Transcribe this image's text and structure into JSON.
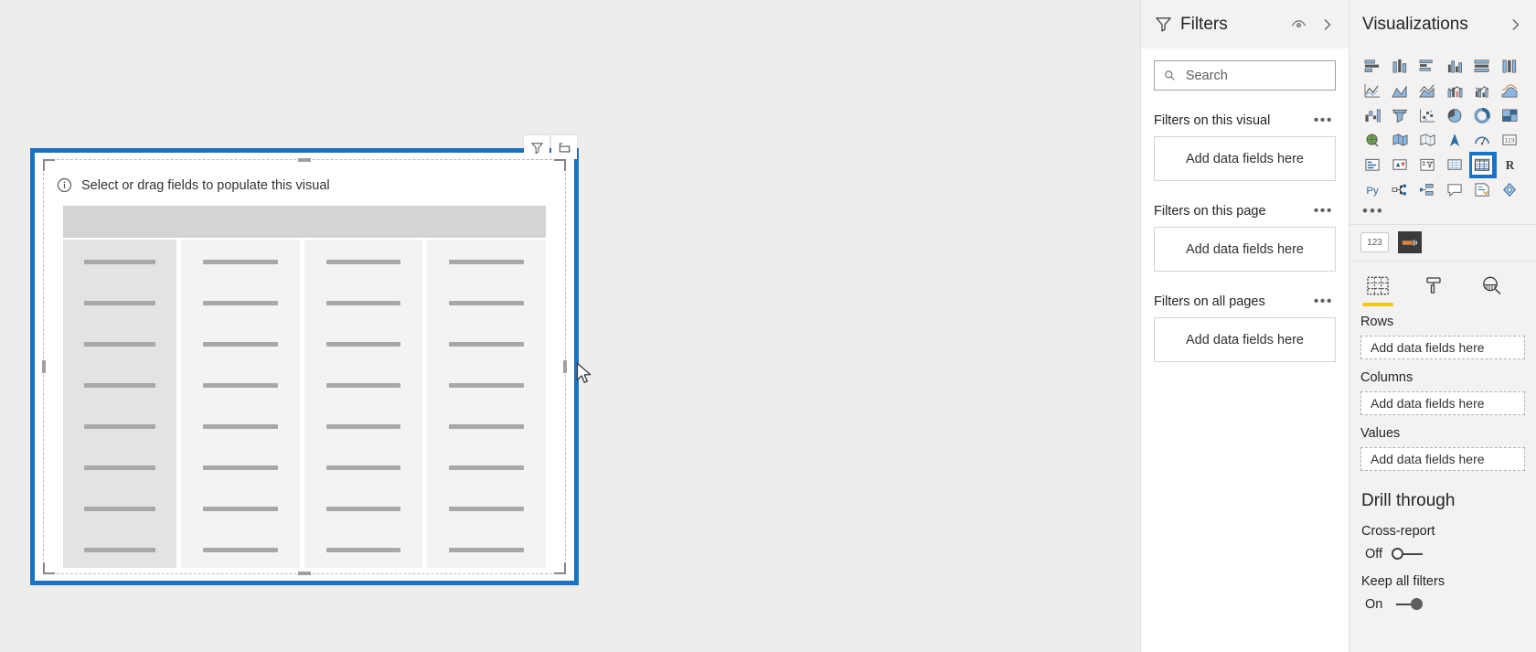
{
  "canvas": {
    "visual": {
      "hint_text": "Select or drag fields to populate this visual",
      "info_icon": "info-circle-icon",
      "header_icons": [
        "filter-icon",
        "focus-mode-icon"
      ],
      "selected": true,
      "selection_color": "#1a72c4",
      "skeleton": {
        "header_color": "#d4d4d4",
        "first_column_color": "#e3e3e3",
        "column_color": "#f3f3f3",
        "row_bar_color": "#a8a8a8",
        "columns": 4,
        "rows": 8
      }
    },
    "background_color": "#ededeb",
    "cursor": "arrow-pointer"
  },
  "filters": {
    "title": "Filters",
    "funnel_icon": "filter-funnel-icon",
    "hide_icon": "eye-hide-icon",
    "expand_icon": "chevron-right-icon",
    "search": {
      "placeholder": "Search",
      "value": "",
      "icon": "search-icon"
    },
    "sections": [
      {
        "title": "Filters on this visual",
        "menu": "•••",
        "drop_label": "Add data fields here"
      },
      {
        "title": "Filters on this page",
        "menu": "•••",
        "drop_label": "Add data fields here"
      },
      {
        "title": "Filters on all pages",
        "menu": "•••",
        "drop_label": "Add data fields here"
      }
    ]
  },
  "visualizations": {
    "title": "Visualizations",
    "expand_icon": "chevron-right-icon",
    "gallery": {
      "selected_index": 28,
      "selected_name": "matrix-visual",
      "icons": [
        "stacked-bar-chart-icon",
        "stacked-column-chart-icon",
        "clustered-bar-chart-icon",
        "clustered-column-chart-icon",
        "100-percent-stacked-bar-chart-icon",
        "100-percent-stacked-column-chart-icon",
        "line-chart-icon",
        "area-chart-icon",
        "stacked-area-chart-icon",
        "line-and-stacked-column-chart-icon",
        "line-and-clustered-column-chart-icon",
        "ribbon-chart-icon",
        "waterfall-chart-icon",
        "funnel-chart-icon",
        "scatter-chart-icon",
        "pie-chart-icon",
        "donut-chart-icon",
        "treemap-icon",
        "map-icon",
        "filled-map-icon",
        "shape-map-icon",
        "arcgis-map-icon",
        "gauge-icon",
        "card-icon",
        "multi-row-card-icon",
        "kpi-icon",
        "slicer-icon",
        "table-icon",
        "matrix-icon",
        "r-script-visual-icon",
        "python-visual-icon",
        "decomposition-tree-icon",
        "key-influencers-icon",
        "smart-narrative-icon",
        "paginated-report-icon",
        "get-more-visuals-icon"
      ],
      "more_button": "•••"
    },
    "format_chips": [
      "123-card-icon",
      "image-fill-icon"
    ],
    "tabs": [
      {
        "name": "fields-tab",
        "icon": "fields-grid-icon",
        "active": true
      },
      {
        "name": "format-tab",
        "icon": "paint-roller-icon",
        "active": false
      },
      {
        "name": "analytics-tab",
        "icon": "magnifier-analytics-icon",
        "active": false
      }
    ],
    "wells": [
      {
        "label": "Rows",
        "drop_label": "Add data fields here"
      },
      {
        "label": "Columns",
        "drop_label": "Add data fields here"
      },
      {
        "label": "Values",
        "drop_label": "Add data fields here"
      }
    ],
    "drill_through": {
      "title": "Drill through",
      "cross_report": {
        "label": "Cross-report",
        "state": "Off",
        "on": false
      },
      "keep_all_filters": {
        "label": "Keep all filters",
        "state": "On",
        "on": true
      }
    }
  },
  "colors": {
    "accent_blue": "#1a72c4",
    "tab_underline": "#f2c811",
    "pane_bg": "#f3f2f1",
    "canvas_bg": "#ededeb"
  }
}
